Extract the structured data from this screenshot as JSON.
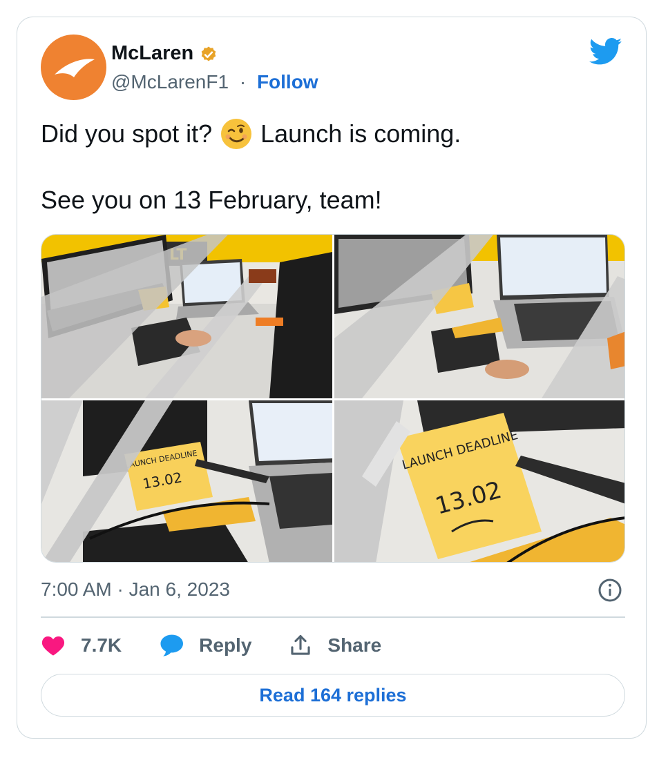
{
  "author": {
    "name": "McLaren",
    "handle": "@McLarenF1",
    "separator": "·",
    "follow_label": "Follow",
    "verified_badge_color": "#e8a328",
    "avatar_color": "#ef8231"
  },
  "icons": {
    "verified": "verified-badge-icon",
    "brand": "twitter-bird-icon",
    "emoji": "winking-face-emoji",
    "info": "info-icon",
    "like": "heart-icon",
    "reply": "speech-bubble-icon",
    "share": "share-upload-icon"
  },
  "tweet": {
    "line1_before_emoji": "Did you spot it?",
    "line1_after_emoji": "Launch is coming.",
    "line2": "See you on 13 February, team!"
  },
  "media": {
    "photo_count": 4,
    "note_heading": "LAUNCH DEADLINE",
    "note_date": "13.02",
    "sign_text": "LT"
  },
  "meta": {
    "timestamp": "7:00 AM · Jan 6, 2023"
  },
  "actions": {
    "like_count": "7.7K",
    "reply_label": "Reply",
    "share_label": "Share",
    "read_replies_label": "Read 164 replies"
  },
  "colors": {
    "accent_blue": "#1d6fd6",
    "twitter_blue": "#1d9bf0",
    "like_pink": "#f91880",
    "muted_text": "#536471",
    "border": "#cfd9de"
  }
}
